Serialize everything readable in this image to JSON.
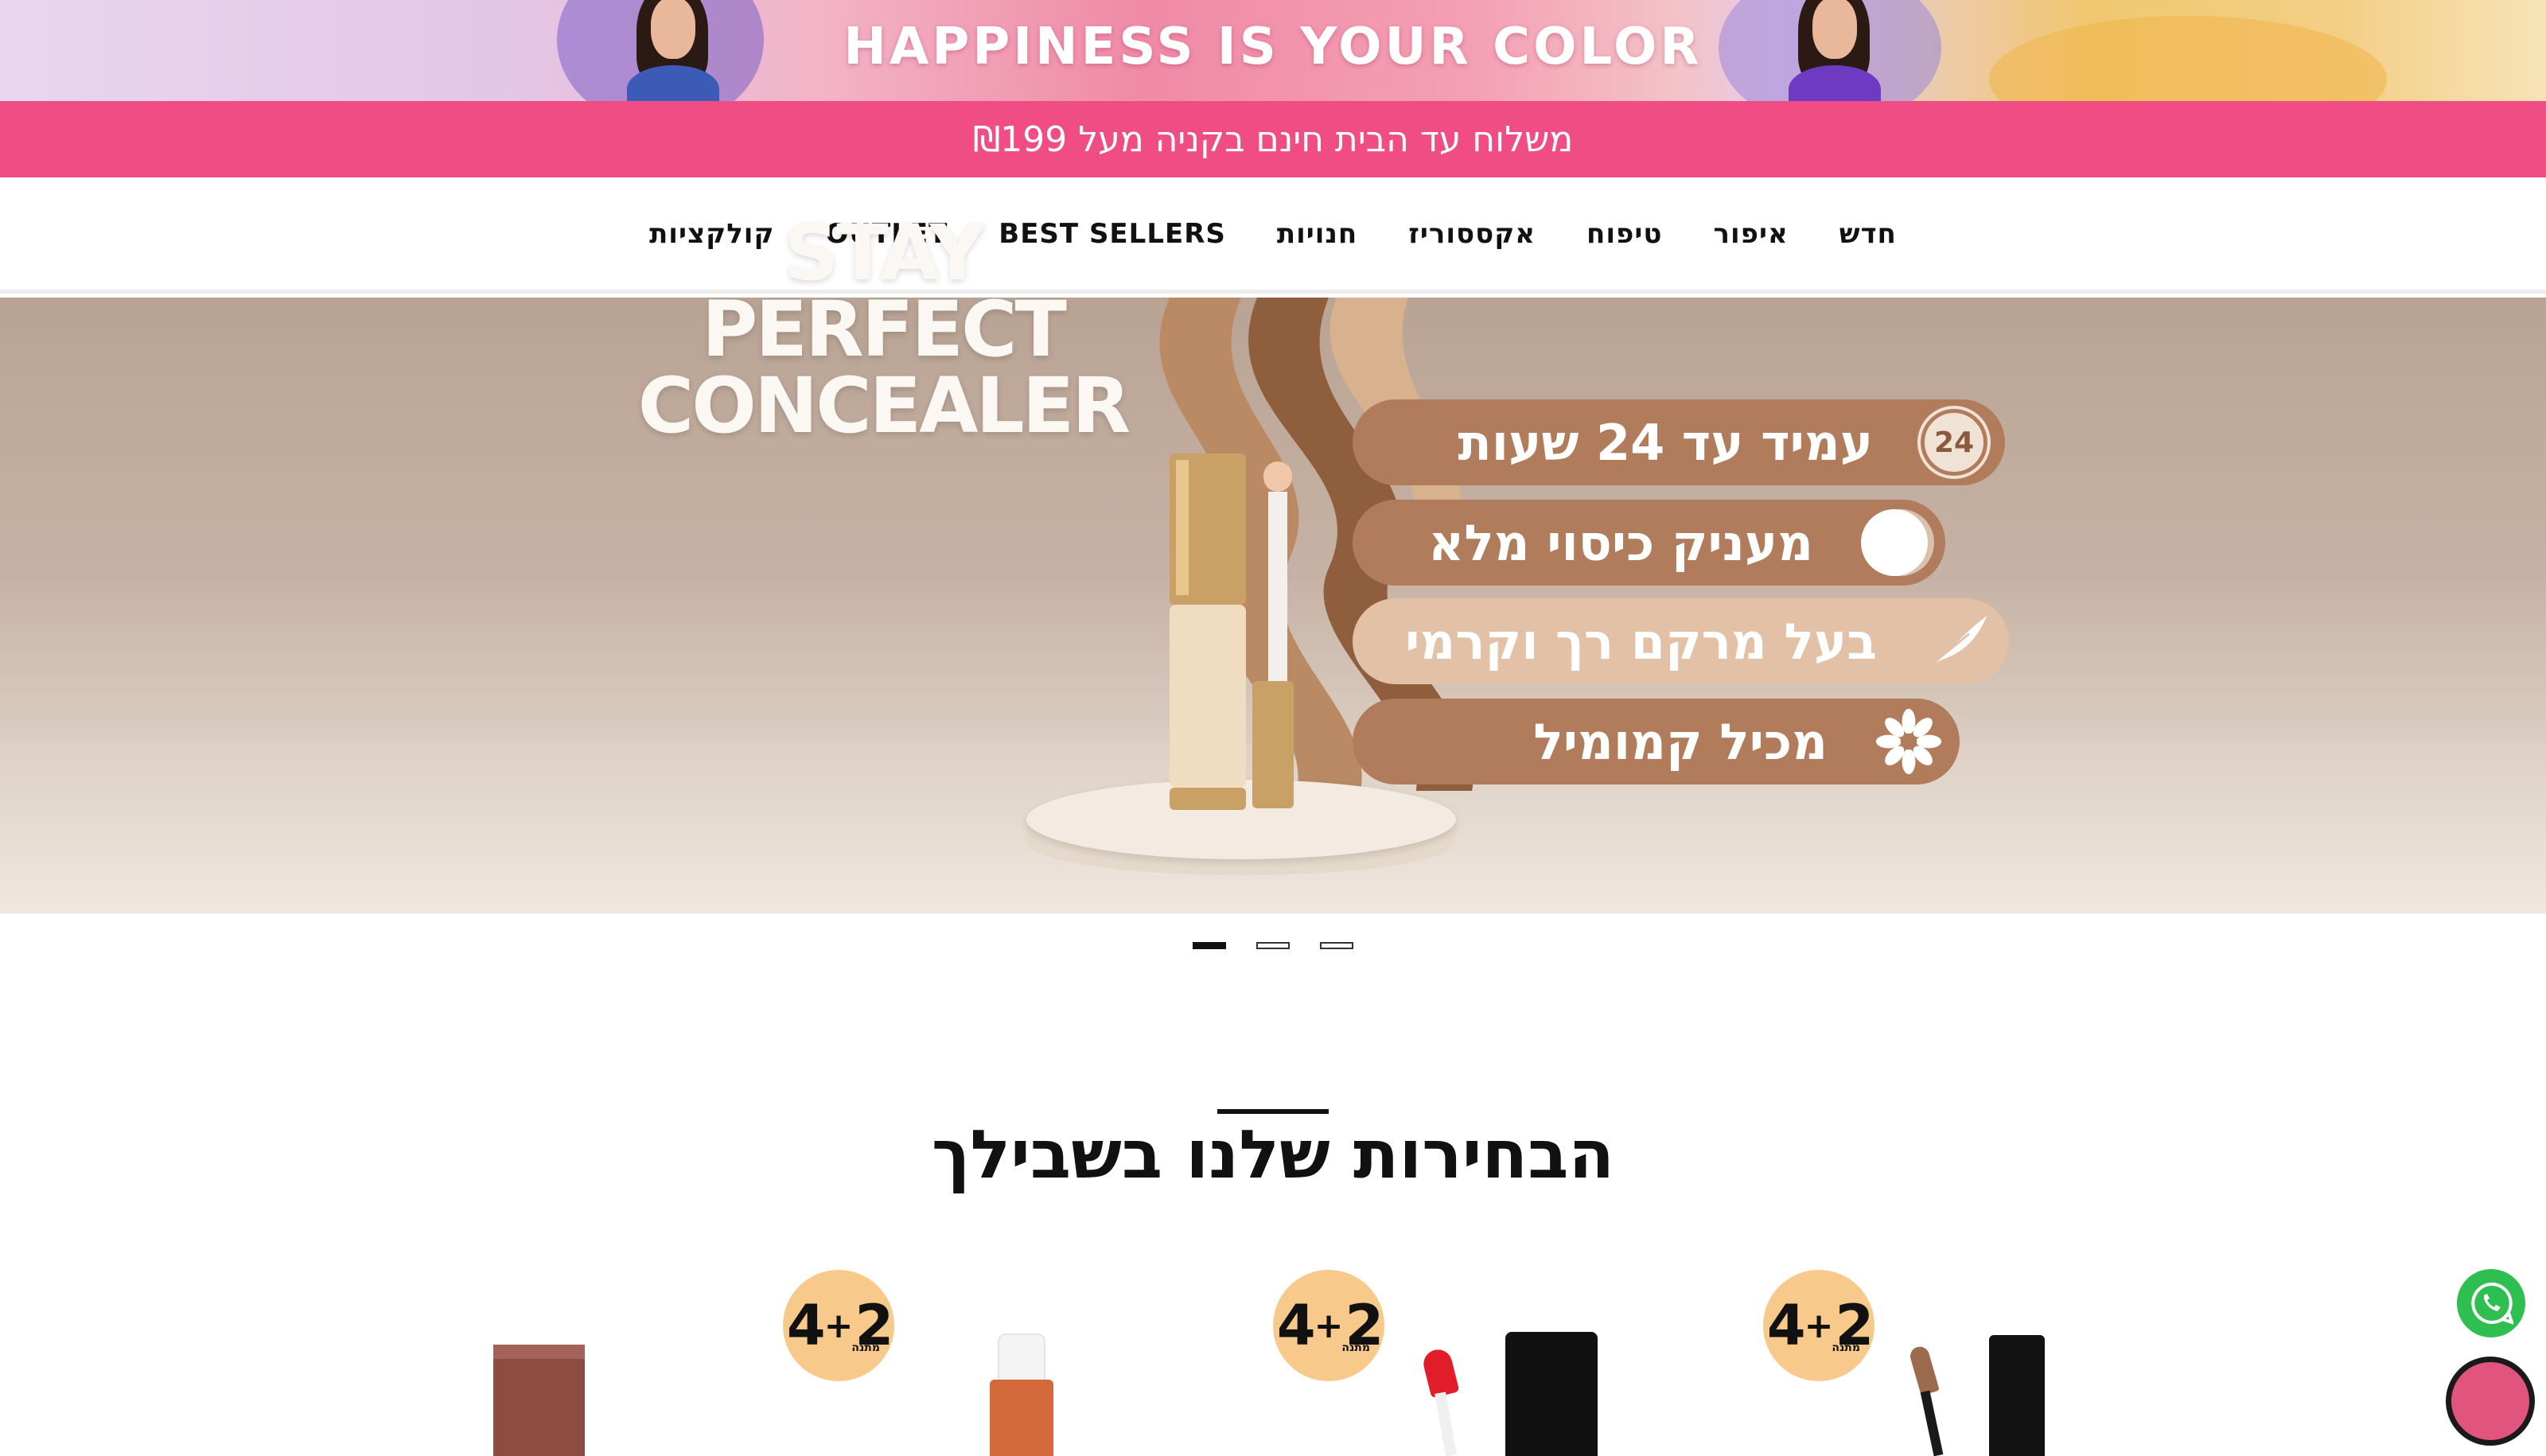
{
  "promo_banner": {
    "title": "HAPPINESS IS YOUR COLOR"
  },
  "shipping_bar": {
    "text": "משלוח עד הבית חינם בקניה מעל ₪199"
  },
  "nav": {
    "items": [
      {
        "label": "חדש"
      },
      {
        "label": "איפור"
      },
      {
        "label": "טיפוח"
      },
      {
        "label": "אקססוריז"
      },
      {
        "label": "חנויות"
      },
      {
        "label": "BEST SELLERS"
      },
      {
        "label": "OUTLET"
      },
      {
        "label": "קולקציות"
      }
    ]
  },
  "hero": {
    "title_line1": "STAY PERFECT",
    "title_line2": "CONCEALER",
    "features": [
      {
        "text": "עמיד עד 24 שעות",
        "icon": "24-hours-icon",
        "badge_text": "24"
      },
      {
        "text": "מעניק כיסוי מלא",
        "icon": "full-coverage-icon"
      },
      {
        "text": "בעל מרקם רך וקרמי",
        "icon": "feather-icon"
      },
      {
        "text": "מכיל קמומיל",
        "icon": "chamomile-flower-icon"
      }
    ],
    "colors": {
      "pill_dark": "#b07c5b",
      "pill_light": "#e2c1a6"
    }
  },
  "carousel": {
    "slides": 3,
    "active_index": 0
  },
  "section": {
    "title": "הבחירות שלנו בשבילך"
  },
  "deals": [
    {
      "num1": "4",
      "plus": "+",
      "num2": "2",
      "gift": "מתנה"
    },
    {
      "num1": "4",
      "plus": "+",
      "num2": "2",
      "gift": "מתנה"
    },
    {
      "num1": "4",
      "plus": "+",
      "num2": "2",
      "gift": "מתנה"
    }
  ],
  "floating": {
    "whatsapp_icon": "whatsapp-icon",
    "chat_icon": "chat-icon",
    "brand_pink": "#ef4d83"
  }
}
